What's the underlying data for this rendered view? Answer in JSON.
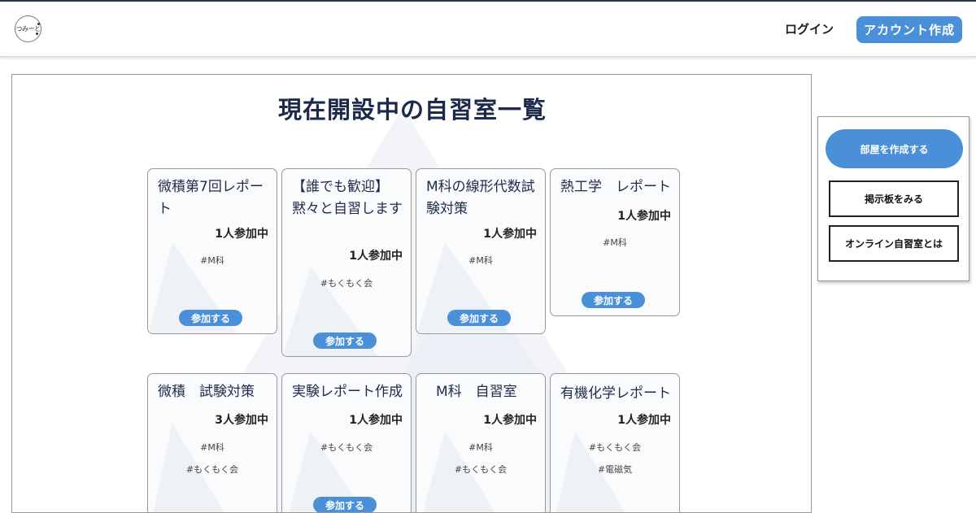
{
  "header": {
    "logo_text": "つみーと",
    "login_label": "ログイン",
    "signup_label": "アカウント作成"
  },
  "main": {
    "title": "現在開設中の自習室一覧",
    "rooms": [
      {
        "title": "微積第7回レポート",
        "count": "1人参加中",
        "tags": [
          "#M科"
        ],
        "join_label": "参加する"
      },
      {
        "title": "【誰でも歓迎】黙々と自習します",
        "count": "1人参加中",
        "tags": [
          "#もくもく会"
        ],
        "join_label": "参加する"
      },
      {
        "title": "M科の線形代数試験対策",
        "count": "1人参加中",
        "tags": [
          "#M科"
        ],
        "join_label": "参加する"
      },
      {
        "title": "熱工学　レポート",
        "count": "1人参加中",
        "tags": [
          "#M科"
        ],
        "join_label": "参加する"
      },
      {
        "title": "微積　試験対策",
        "count": "3人参加中",
        "tags": [
          "#M科",
          "#もくもく会"
        ]
      },
      {
        "title": "実験レポート作成",
        "count": "1人参加中",
        "tags": [
          "#もくもく会"
        ],
        "join_label": "参加する"
      },
      {
        "title": "M科　自習室",
        "count": "1人参加中",
        "tags": [
          "#M科",
          "#もくもく会"
        ]
      },
      {
        "title": "有機化学レポート",
        "count": "1人参加中",
        "tags": [
          "#もくもく会",
          "#電磁気"
        ]
      }
    ]
  },
  "sidebar": {
    "create_room_label": "部屋を作成する",
    "board_label": "掲示板をみる",
    "about_label": "オンライン自習室とは"
  },
  "colors": {
    "accent": "#4a90d9",
    "title_text": "#1c2a4a",
    "mountain": "#eef1f6"
  }
}
